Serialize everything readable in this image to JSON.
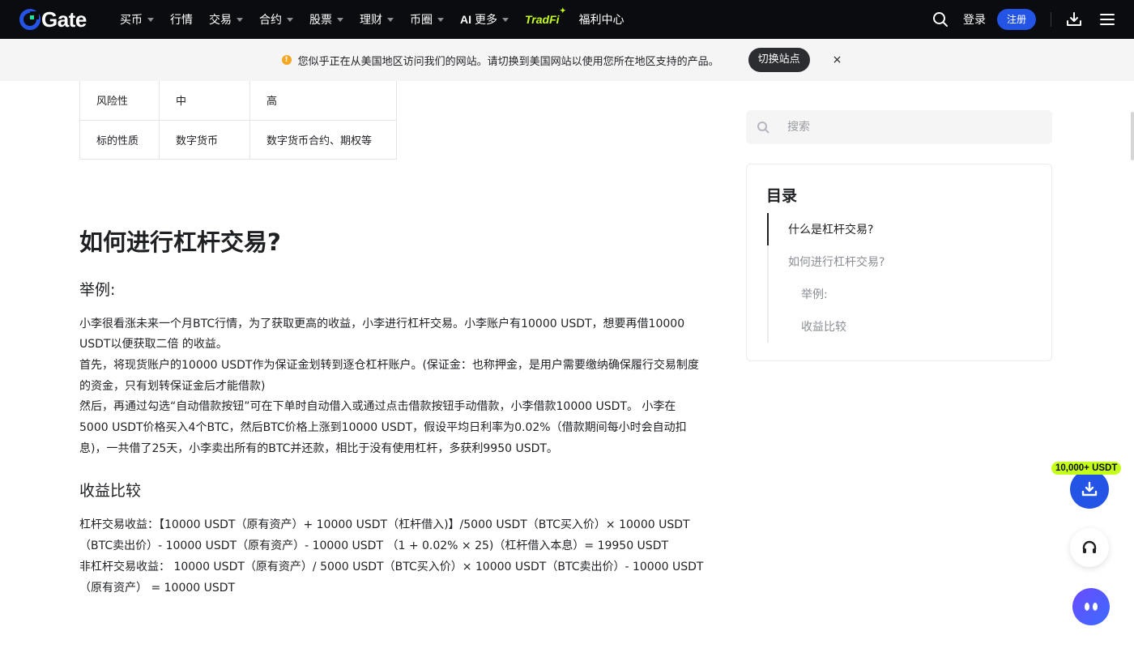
{
  "nav": {
    "logo_text": "Gate",
    "items": [
      {
        "label": "买币",
        "caret": true
      },
      {
        "label": "行情",
        "caret": false
      },
      {
        "label": "交易",
        "caret": true
      },
      {
        "label": "合约",
        "caret": true
      },
      {
        "label": "股票",
        "caret": true
      },
      {
        "label": "理财",
        "caret": true
      },
      {
        "label": "币圈",
        "caret": true
      }
    ],
    "more_label": "更多",
    "ai_label": "AI",
    "tradfi_label": "TradFi",
    "rewards_label": "福利中心",
    "login_label": "登录",
    "register_label": "注册"
  },
  "notice": {
    "text": "您似乎正在从美国地区访问我们的网站。请切换到美国网站以使用您所在地区支持的产品。",
    "switch_label": "切换站点",
    "close_glyph": "×"
  },
  "table": {
    "rows": [
      [
        "风险性",
        "中",
        "高"
      ],
      [
        "标的性质",
        "数字货币",
        "数字货币合约、期权等"
      ]
    ]
  },
  "article": {
    "heading": "如何进行杠杆交易?",
    "example_heading": "举例:",
    "example_paragraphs": [
      "小李很看涨未来一个月BTC行情，为了获取更高的收益，小李进行杠杆交易。小李账户有10000 USDT，想要再借10000 USDT以便获取二倍 的收益。",
      "首先，将现货账户的10000 USDT作为保证金划转到逐仓杠杆账户。(保证金：也称押金，是用户需要缴纳确保履行交易制度的资金，只有划转保证金后才能借款)",
      "然后，再通过勾选“自动借款按钮”可在下单时自动借入或通过点击借款按钮手动借款，小李借款10000 USDT。 小李在5000 USDT价格买入4个BTC，然后BTC价格上涨到10000 USDT，假设平均日利率为0.02%（借款期间每小时会自动扣息)，一共借了25天，小李卖出所有的BTC并还款，相比于没有使用杠杆，多获利9950 USDT。"
    ],
    "compare_heading": "收益比较",
    "compare_paragraphs": [
      "杠杆交易收益：【10000 USDT（原有资产）+ 10000 USDT（杠杆借入)】/5000 USDT（BTC买入价）× 10000 USDT（BTC卖出价）- 10000 USDT（原有资产）- 10000 USDT （1 + 0.02% × 25)（杠杆借入本息）= 19950 USDT",
      "非杠杆交易收益： 10000 USDT（原有资产）/ 5000 USDT（BTC买入价）× 10000 USDT（BTC卖出价）- 10000 USDT（原有资产） = 10000 USDT"
    ]
  },
  "sidebar": {
    "search_placeholder": "搜索",
    "toc_title": "目录",
    "toc_items": [
      {
        "label": "什么是杠杆交易?",
        "active": true
      },
      {
        "label": "如何进行杠杆交易?",
        "active": false
      },
      {
        "label": "举例:",
        "active": false
      },
      {
        "label": "收益比较",
        "active": false
      }
    ]
  },
  "floating": {
    "promo_label": "10,000+ USDT"
  },
  "colors": {
    "nav_bg": "#0b0c0f",
    "brand_blue": "#2354e6",
    "accent_green": "#c4ff1a",
    "warning": "#f5a623"
  }
}
